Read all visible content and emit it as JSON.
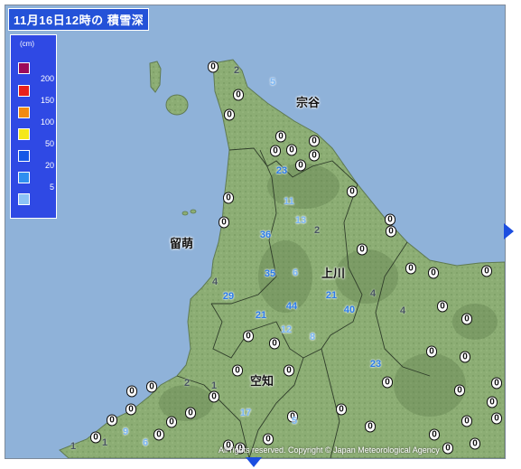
{
  "title": "11月16日12時の 積雪深",
  "legend": {
    "unit": "(cm)",
    "items": [
      {
        "label": "",
        "color": "#9c0a5a"
      },
      {
        "label": "200",
        "color": "#e8201a"
      },
      {
        "label": "150",
        "color": "#f28a12"
      },
      {
        "label": "100",
        "color": "#f5e81a"
      },
      {
        "label": "50",
        "color": "#1458e6"
      },
      {
        "label": "20",
        "color": "#2f8ef0"
      },
      {
        "label": "5",
        "color": "#8cc2f5"
      }
    ]
  },
  "places": [
    "宗谷",
    "留萌",
    "上川",
    "空知"
  ],
  "readings": [
    {
      "v": "0",
      "k": "zero"
    },
    {
      "v": "2",
      "k": "low"
    },
    {
      "v": "5",
      "k": "light"
    },
    {
      "v": "0",
      "k": "zero"
    },
    {
      "v": "0",
      "k": "zero"
    },
    {
      "v": "0",
      "k": "zero"
    },
    {
      "v": "0",
      "k": "zero"
    },
    {
      "v": "0",
      "k": "zero"
    },
    {
      "v": "0",
      "k": "zero"
    },
    {
      "v": "0",
      "k": "zero"
    },
    {
      "v": "23",
      "k": "mid"
    },
    {
      "v": "0",
      "k": "zero"
    },
    {
      "v": "0",
      "k": "zero"
    },
    {
      "v": "11",
      "k": "light"
    },
    {
      "v": "13",
      "k": "light"
    },
    {
      "v": "0",
      "k": "zero"
    },
    {
      "v": "0",
      "k": "zero"
    },
    {
      "v": "36",
      "k": "mid"
    },
    {
      "v": "2",
      "k": "low"
    },
    {
      "v": "0",
      "k": "zero"
    },
    {
      "v": "0",
      "k": "zero"
    },
    {
      "v": "0",
      "k": "zero"
    },
    {
      "v": "0",
      "k": "zero"
    },
    {
      "v": "4",
      "k": "low"
    },
    {
      "v": "35",
      "k": "mid"
    },
    {
      "v": "6",
      "k": "light"
    },
    {
      "v": "29",
      "k": "mid"
    },
    {
      "v": "44",
      "k": "mid"
    },
    {
      "v": "21",
      "k": "mid"
    },
    {
      "v": "4",
      "k": "low"
    },
    {
      "v": "0",
      "k": "zero"
    },
    {
      "v": "0",
      "k": "zero"
    },
    {
      "v": "21",
      "k": "mid"
    },
    {
      "v": "40",
      "k": "mid"
    },
    {
      "v": "4",
      "k": "low"
    },
    {
      "v": "0",
      "k": "zero"
    },
    {
      "v": "12",
      "k": "light"
    },
    {
      "v": "0",
      "k": "zero"
    },
    {
      "v": "0",
      "k": "zero"
    },
    {
      "v": "8",
      "k": "light"
    },
    {
      "v": "0",
      "k": "zero"
    },
    {
      "v": "0",
      "k": "zero"
    },
    {
      "v": "0",
      "k": "zero"
    },
    {
      "v": "23",
      "k": "mid"
    },
    {
      "v": "0",
      "k": "zero"
    },
    {
      "v": "0",
      "k": "zero"
    },
    {
      "v": "0",
      "k": "zero"
    },
    {
      "v": "0",
      "k": "zero"
    },
    {
      "v": "0",
      "k": "zero"
    },
    {
      "v": "0",
      "k": "zero"
    },
    {
      "v": "2",
      "k": "low"
    },
    {
      "v": "1",
      "k": "low"
    },
    {
      "v": "0",
      "k": "zero"
    },
    {
      "v": "0",
      "k": "zero"
    },
    {
      "v": "0",
      "k": "zero"
    },
    {
      "v": "0",
      "k": "zero"
    },
    {
      "v": "0",
      "k": "zero"
    },
    {
      "v": "0",
      "k": "zero"
    },
    {
      "v": "0",
      "k": "zero"
    },
    {
      "v": "17",
      "k": "light"
    },
    {
      "v": "0",
      "k": "zero"
    },
    {
      "v": "0",
      "k": "zero"
    },
    {
      "v": "5",
      "k": "light"
    },
    {
      "v": "0",
      "k": "zero"
    },
    {
      "v": "0",
      "k": "zero"
    },
    {
      "v": "9",
      "k": "light"
    },
    {
      "v": "0",
      "k": "zero"
    },
    {
      "v": "0",
      "k": "zero"
    },
    {
      "v": "0",
      "k": "zero"
    },
    {
      "v": "1",
      "k": "low"
    },
    {
      "v": "6",
      "k": "light"
    },
    {
      "v": "1",
      "k": "low"
    },
    {
      "v": "0",
      "k": "zero"
    },
    {
      "v": "0",
      "k": "zero"
    },
    {
      "v": "0",
      "k": "zero"
    },
    {
      "v": "0",
      "k": "zero"
    },
    {
      "v": "0",
      "k": "zero"
    },
    {
      "v": "0",
      "k": "zero"
    }
  ],
  "copyright": "All rights reserved. Copyright © Japan Meteorological Agency",
  "colors": {
    "sea": "#8fb2d9",
    "land": "#8cad74",
    "zero_marker": "#ffffff",
    "value_blue": "#2d7de8",
    "value_light": "#7bb6f2"
  },
  "icons": {
    "east": "arrow-right-icon",
    "south": "arrow-down-icon"
  }
}
